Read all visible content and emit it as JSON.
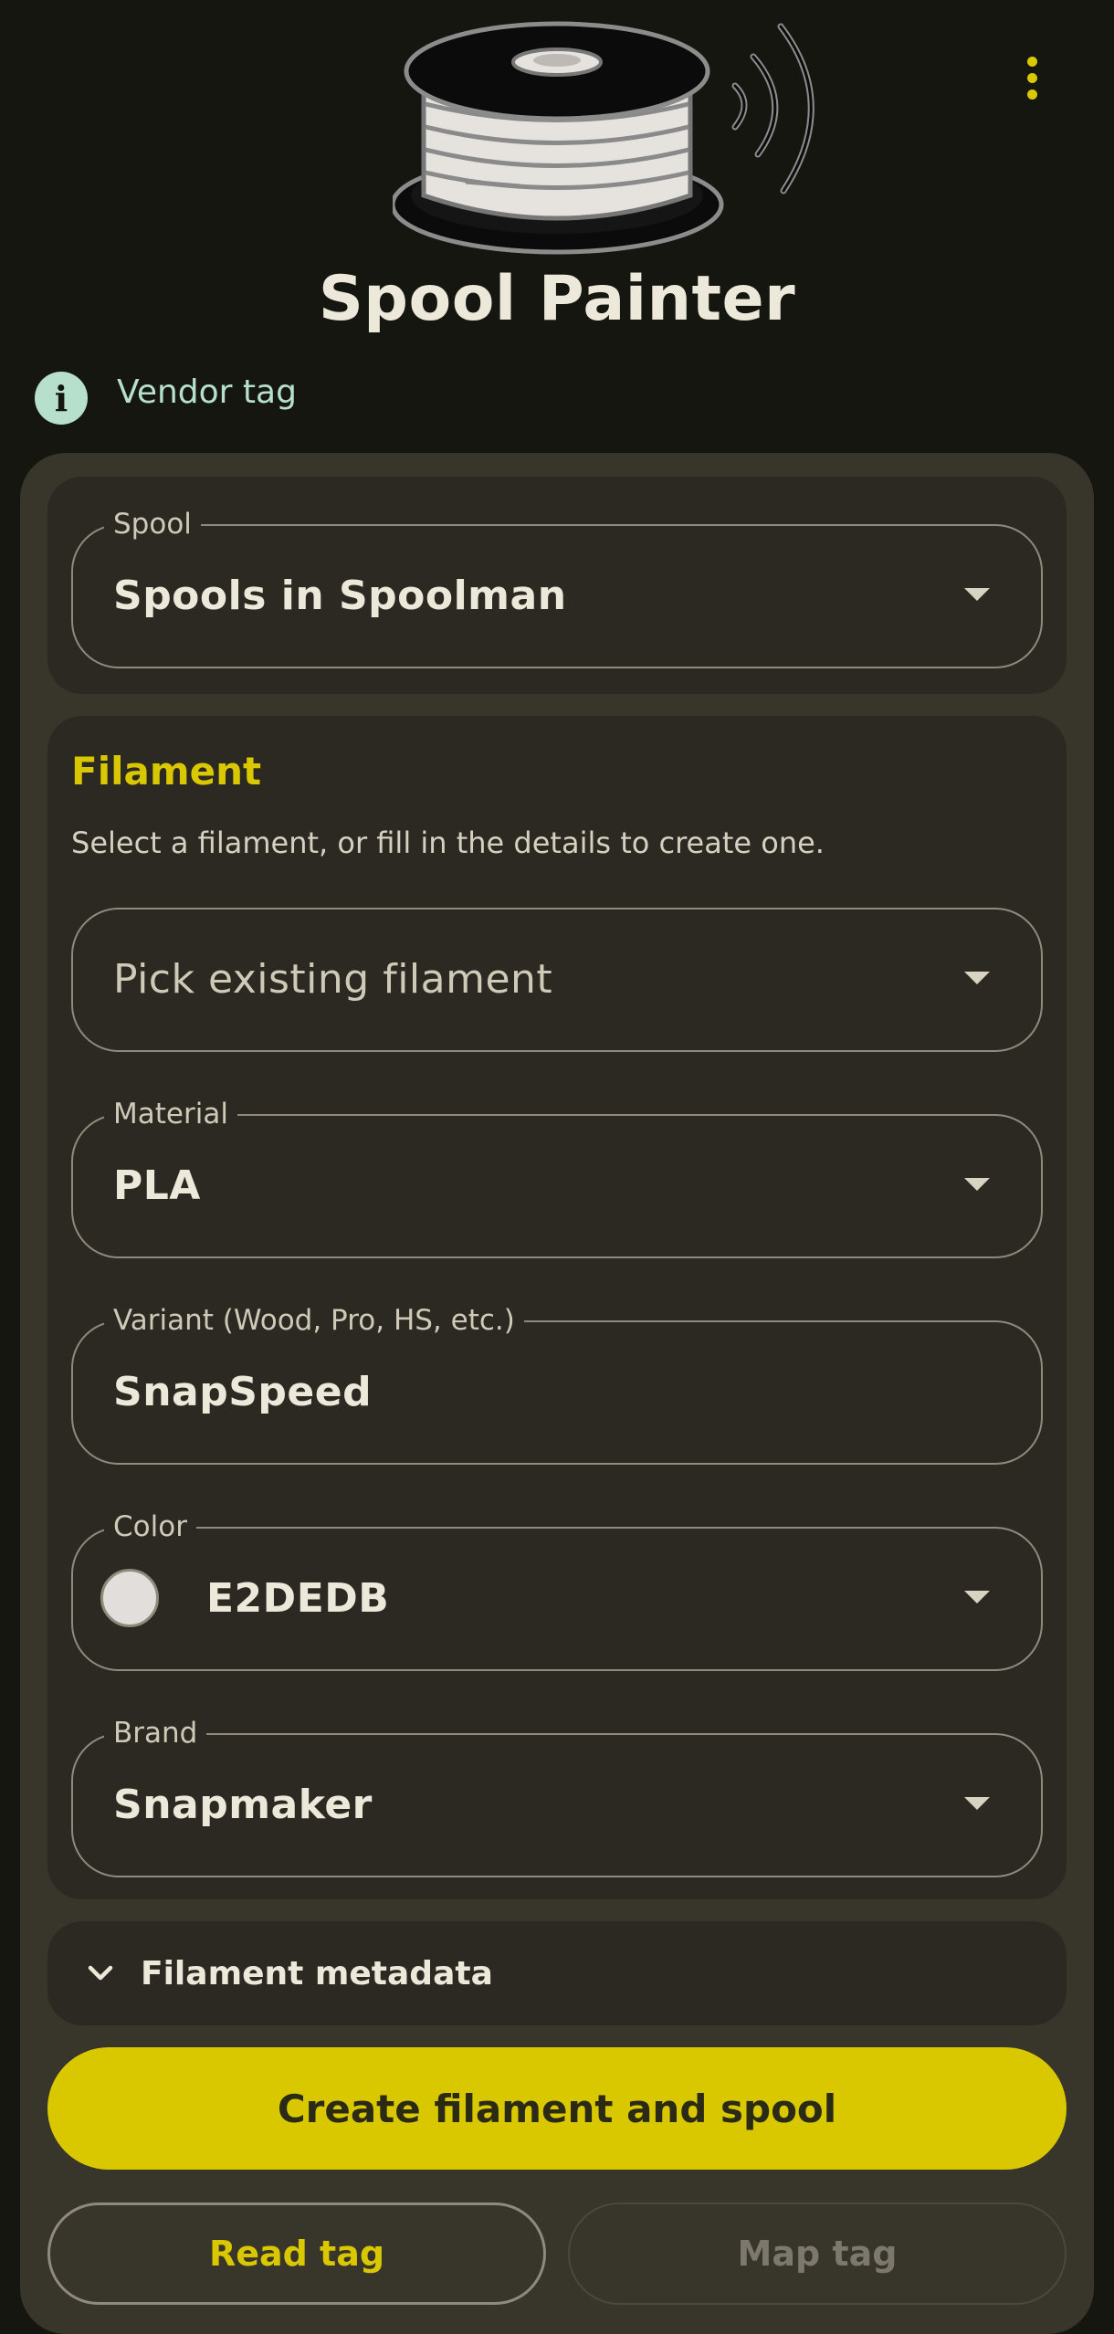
{
  "app": {
    "title": "Spool Painter"
  },
  "vendor": {
    "label": "Vendor tag"
  },
  "spool": {
    "label": "Spool",
    "value": "Spools in Spoolman"
  },
  "filament": {
    "title": "Filament",
    "description": "Select a filament, or fill in the details to create one.",
    "pick_placeholder": "Pick existing filament",
    "material": {
      "label": "Material",
      "value": "PLA"
    },
    "variant": {
      "label": "Variant (Wood, Pro, HS, etc.)",
      "value": "SnapSpeed"
    },
    "color": {
      "label": "Color",
      "value": "E2DEDB",
      "swatch": "#E2DEDB"
    },
    "brand": {
      "label": "Brand",
      "value": "Snapmaker"
    }
  },
  "metadata": {
    "label": "Filament metadata"
  },
  "actions": {
    "create": "Create filament and spool",
    "read_tag": "Read tag",
    "map_tag": "Map tag"
  },
  "colors": {
    "accent": "#d9c800",
    "info": "#b7e0cc",
    "background": "#161610"
  }
}
